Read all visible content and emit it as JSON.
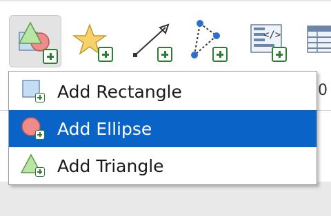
{
  "toolbar": {
    "buttons": [
      {
        "name": "add-shape",
        "icon": "shapes-icon",
        "active": true
      },
      {
        "name": "add-star",
        "icon": "star-icon"
      },
      {
        "name": "add-line",
        "icon": "arrow-line-icon"
      },
      {
        "name": "add-polyline",
        "icon": "polyline-icon"
      },
      {
        "name": "add-html",
        "icon": "html-code-icon"
      },
      {
        "name": "add-table",
        "icon": "table-icon"
      }
    ]
  },
  "ruler": {
    "visible_tick": "0"
  },
  "menu": {
    "items": [
      {
        "label": "Add Rectangle",
        "icon": "rectangle-icon",
        "selected": false
      },
      {
        "label": "Add Ellipse",
        "icon": "ellipse-icon",
        "selected": true
      },
      {
        "label": "Add Triangle",
        "icon": "triangle-icon",
        "selected": false
      }
    ]
  },
  "colors": {
    "selection": "#0a64c8",
    "plus_green": "#2e7d32",
    "shape_fill_blue": "#c5ddf3",
    "shape_fill_red": "#f08b8b",
    "shape_fill_green": "#b9e6a6",
    "star_fill": "#f7d26b"
  }
}
